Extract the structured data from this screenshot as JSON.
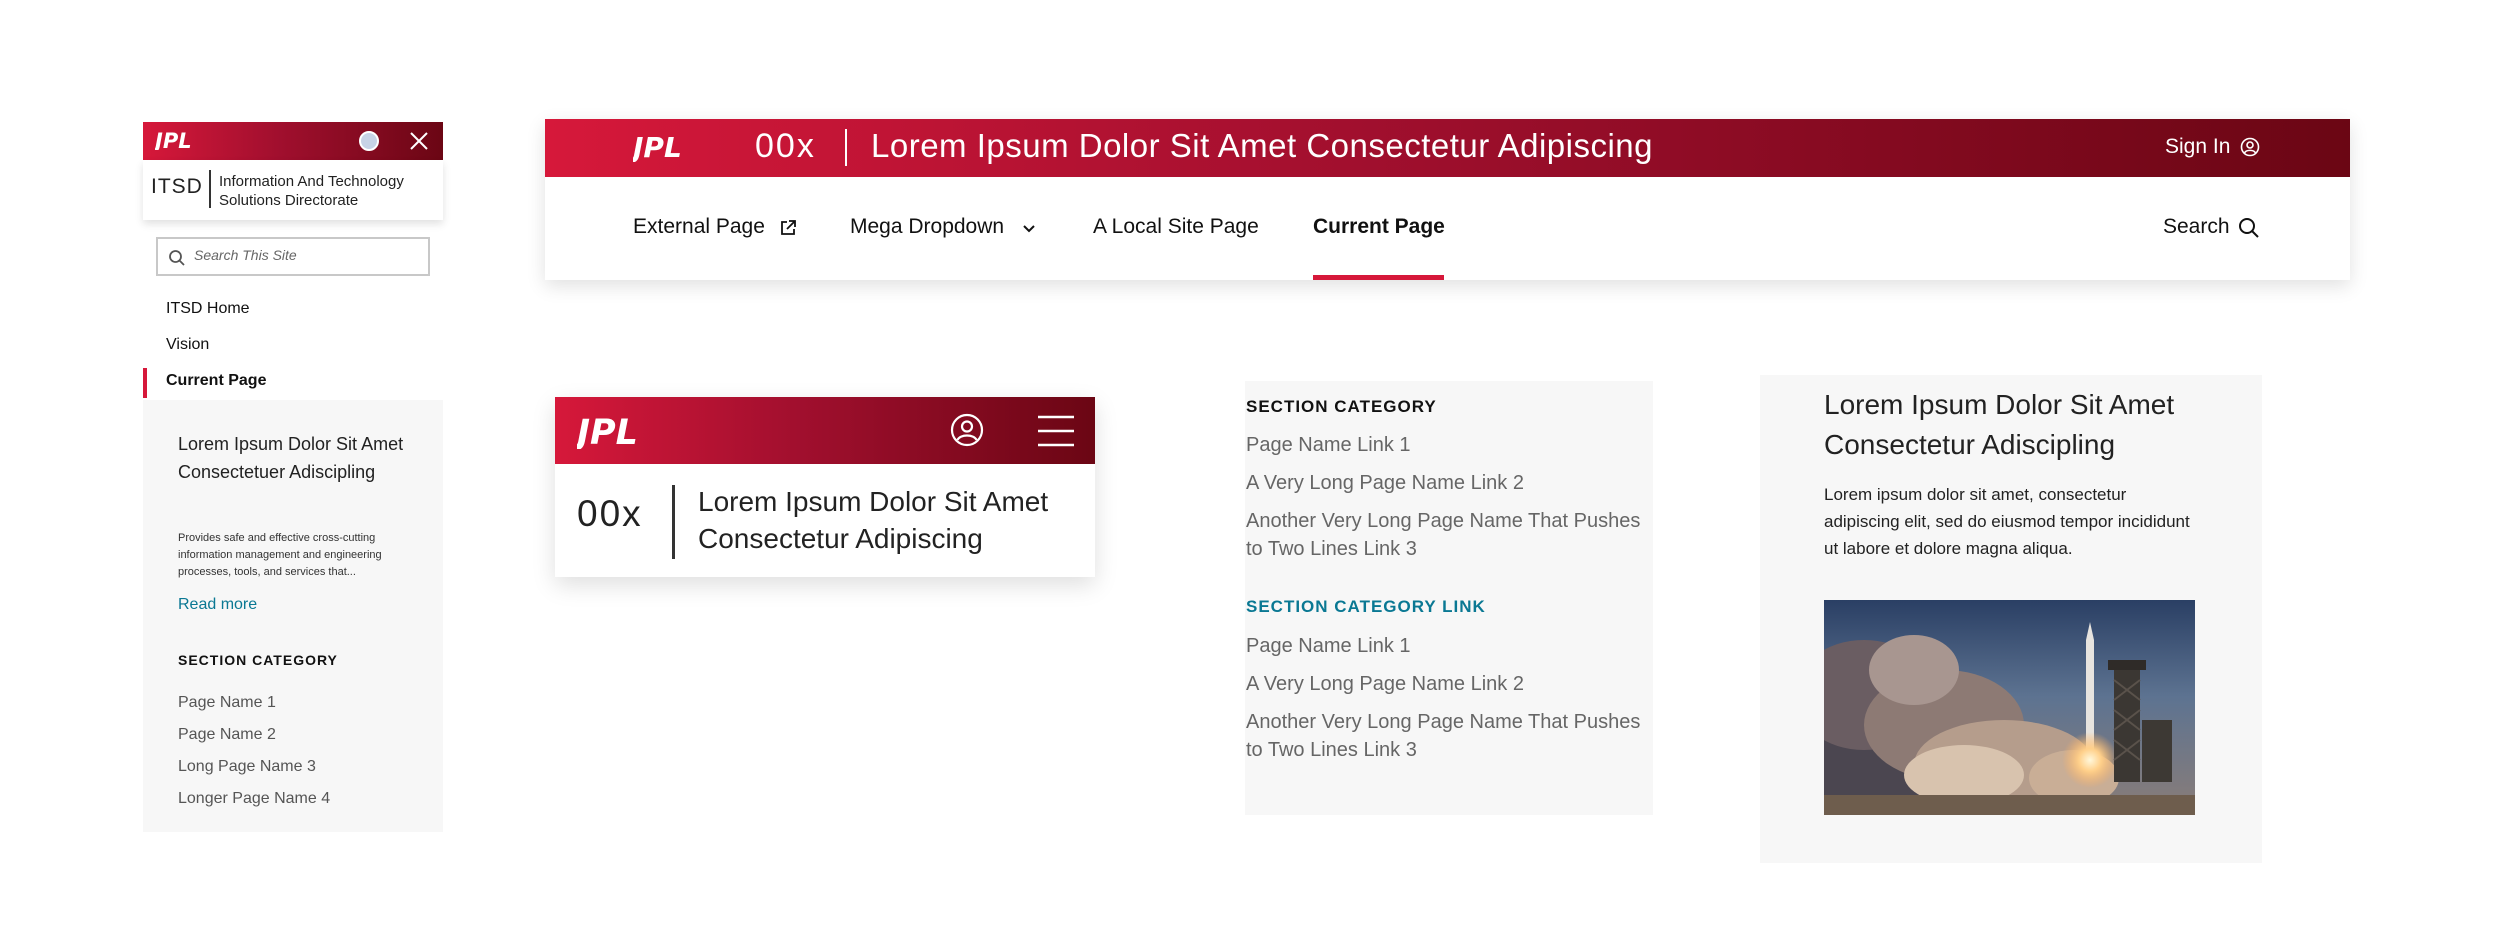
{
  "brand": {
    "logo_text": "JPL",
    "colors": {
      "primary_red": "#d6183a",
      "dark_red": "#6b0614",
      "link_teal": "#0a7893",
      "panel_gray": "#f7f7f7"
    }
  },
  "sidebar": {
    "icons": {
      "user": "user-avatar-icon",
      "close": "close-icon",
      "search": "search-icon"
    },
    "site_abbr": "ITSD",
    "site_name": "Information And Technology Solutions Directorate",
    "search_placeholder": "Search This Site",
    "nav": [
      "ITSD Home",
      "Vision",
      "Current Page"
    ],
    "current_index": 2,
    "panel": {
      "title": "Lorem Ipsum Dolor Sit Amet Consectetuer Adiscipling",
      "description": "Provides safe and effective cross-cutting information management and engineering processes, tools, and services that...",
      "read_more": "Read more",
      "section_category": "SECTION CATEGORY",
      "links": [
        "Page Name 1",
        "Page Name 2",
        "Long Page Name 3",
        "Longer Page Name 4"
      ]
    }
  },
  "top_header": {
    "site_number": "00x",
    "site_title": "Lorem Ipsum Dolor Sit Amet Consectetur Adipiscing",
    "sign_in": "Sign In",
    "nav": [
      {
        "label": "External Page",
        "icon": "external-link-icon"
      },
      {
        "label": "Mega Dropdown",
        "icon": "chevron-down-icon"
      },
      {
        "label": "A Local Site Page"
      },
      {
        "label": "Current Page",
        "current": true
      }
    ],
    "search": "Search"
  },
  "mobile_header": {
    "site_number": "00x",
    "site_title": "Lorem Ipsum Dolor Sit Amet Consectetur Adipiscing",
    "icons": [
      "user-icon",
      "hamburger-menu-icon"
    ]
  },
  "section_panel": {
    "groups": [
      {
        "heading": "SECTION CATEGORY",
        "is_link": false,
        "links": [
          "Page Name Link 1",
          "A Very Long Page Name Link 2",
          "Another Very Long Page Name That Pushes to Two Lines Link 3"
        ]
      },
      {
        "heading": "SECTION CATEGORY LINK",
        "is_link": true,
        "links": [
          "Page Name Link 1",
          "A Very Long Page Name Link 2",
          "Another Very Long Page Name That Pushes to Two Lines Link 3"
        ]
      }
    ]
  },
  "article_card": {
    "title": "Lorem Ipsum Dolor Sit Amet Consectetur Adiscipling",
    "body": "Lorem ipsum dolor sit amet, consectetur adipiscing elit, sed do eiusmod tempor incididunt ut labore et dolore magna aliqua.",
    "image": "rocket-launch-image"
  }
}
